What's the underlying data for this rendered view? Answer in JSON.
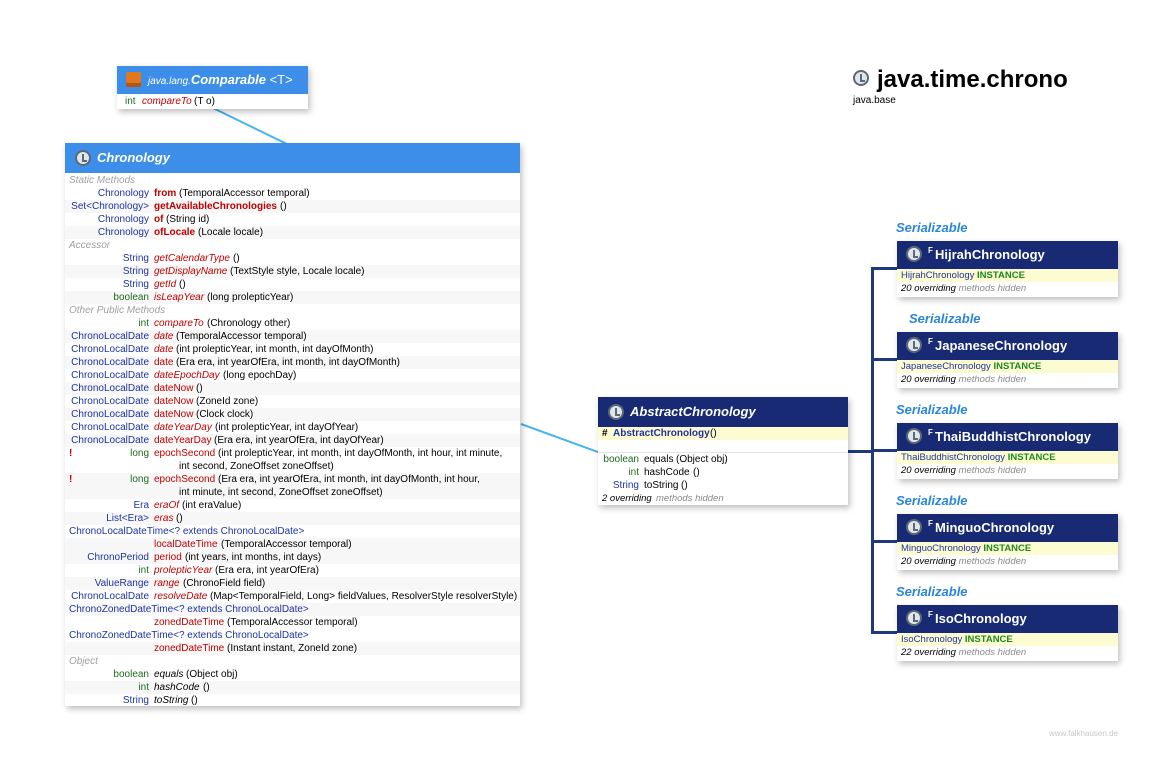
{
  "package": {
    "title": "java.time.chrono",
    "module": "java.base"
  },
  "comparable": {
    "prefix": "java.lang.",
    "name": "Comparable",
    "generic": "<T>",
    "method": {
      "ret": "int",
      "name": "compareTo",
      "params": "(T o)"
    }
  },
  "chronology": {
    "name": "Chronology",
    "sections": {
      "static": "Static Methods",
      "accessor": "Accessor",
      "other": "Other Public Methods",
      "object": "Object"
    },
    "static_rows": [
      {
        "ret": "Chronology",
        "name": "from",
        "params": "(TemporalAccessor temporal)"
      },
      {
        "ret": "Set<Chronology>",
        "name": "getAvailableChronologies",
        "params": "()"
      },
      {
        "ret": "Chronology",
        "name": "of",
        "params": "(String id)"
      },
      {
        "ret": "Chronology",
        "name": "ofLocale",
        "params": "(Locale locale)"
      }
    ],
    "accessor_rows": [
      {
        "ret": "String",
        "name": "getCalendarType",
        "params": "()"
      },
      {
        "ret": "String",
        "name": "getDisplayName",
        "params": "(TextStyle style, Locale locale)"
      },
      {
        "ret": "String",
        "name": "getId",
        "params": "()"
      },
      {
        "ret": "boolean",
        "name": "isLeapYear",
        "params": "(long prolepticYear)"
      }
    ],
    "other_rows": [
      {
        "ret": "int",
        "name": "compareTo",
        "params": "(Chronology other)",
        "style": "it"
      },
      {
        "ret": "ChronoLocalDate",
        "name": "date",
        "params": "(TemporalAccessor temporal)",
        "style": "it"
      },
      {
        "ret": "ChronoLocalDate",
        "name": "date",
        "params": "(int prolepticYear, int month, int dayOfMonth)",
        "style": "it"
      },
      {
        "ret": "ChronoLocalDate",
        "name": "date",
        "params": "(Era era, int yearOfEra, int month, int dayOfMonth)",
        "style": "pl"
      },
      {
        "ret": "ChronoLocalDate",
        "name": "dateEpochDay",
        "params": "(long epochDay)",
        "style": "it"
      },
      {
        "ret": "ChronoLocalDate",
        "name": "dateNow",
        "params": "()",
        "style": "pl"
      },
      {
        "ret": "ChronoLocalDate",
        "name": "dateNow",
        "params": "(ZoneId zone)",
        "style": "pl"
      },
      {
        "ret": "ChronoLocalDate",
        "name": "dateNow",
        "params": "(Clock clock)",
        "style": "pl"
      },
      {
        "ret": "ChronoLocalDate",
        "name": "dateYearDay",
        "params": "(int prolepticYear, int dayOfYear)",
        "style": "it"
      },
      {
        "ret": "ChronoLocalDate",
        "name": "dateYearDay",
        "params": "(Era era, int yearOfEra, int dayOfYear)",
        "style": "pl"
      },
      {
        "flag": "!",
        "ret": "long",
        "name": "epochSecond",
        "params": "(int prolepticYear, int month, int dayOfMonth, int hour, int minute,",
        "cont": "int second, ZoneOffset zoneOffset)",
        "style": "pl"
      },
      {
        "flag": "!",
        "ret": "long",
        "name": "epochSecond",
        "params": "(Era era, int yearOfEra, int month, int dayOfMonth, int hour,",
        "cont": "int minute, int second, ZoneOffset zoneOffset)",
        "style": "pl"
      },
      {
        "ret": "Era",
        "name": "eraOf",
        "params": "(int eraValue)",
        "style": "it"
      },
      {
        "ret": "List<Era>",
        "name": "eras",
        "params": "()",
        "style": "it"
      },
      {
        "ret": "ChronoLocalDateTime<? extends ChronoLocalDate>",
        "name": "localDateTime",
        "params": "(TemporalAccessor temporal)",
        "style": "pl",
        "wide": true
      },
      {
        "ret": "ChronoPeriod",
        "name": "period",
        "params": "(int years, int months, int days)",
        "style": "pl"
      },
      {
        "ret": "int",
        "name": "prolepticYear",
        "params": "(Era era, int yearOfEra)",
        "style": "it"
      },
      {
        "ret": "ValueRange",
        "name": "range",
        "params": "(ChronoField field)",
        "style": "it"
      },
      {
        "ret": "ChronoLocalDate",
        "name": "resolveDate",
        "params": "(Map<TemporalField, Long> fieldValues, ResolverStyle resolverStyle)",
        "style": "it"
      },
      {
        "ret": "ChronoZonedDateTime<? extends ChronoLocalDate>",
        "name": "zonedDateTime",
        "params": "(TemporalAccessor temporal)",
        "style": "pl",
        "wide": true
      },
      {
        "ret": "ChronoZonedDateTime<? extends ChronoLocalDate>",
        "name": "zonedDateTime",
        "params": "(Instant instant, ZoneId zone)",
        "style": "pl",
        "wide": true
      }
    ],
    "object_rows": [
      {
        "ret": "boolean",
        "name": "equals",
        "params": "(Object obj)"
      },
      {
        "ret": "int",
        "name": "hashCode",
        "params": "()"
      },
      {
        "ret": "String",
        "name": "toString",
        "params": "()"
      }
    ]
  },
  "abstract": {
    "name": "AbstractChronology",
    "ctor": {
      "flag": "#",
      "name": "AbstractChronology",
      "params": "()"
    },
    "rows": [
      {
        "ret": "boolean",
        "name": "equals",
        "params": "(Object obj)"
      },
      {
        "ret": "int",
        "name": "hashCode",
        "params": "()"
      },
      {
        "ret": "String",
        "name": "toString",
        "params": "()"
      }
    ],
    "hidden": {
      "count": "2 overriding",
      "rest": "methods hidden"
    }
  },
  "subclasses": [
    {
      "marker": "Serializable",
      "flag": "F",
      "name": "HijrahChronology",
      "inst_type": "HijrahChronology",
      "inst": "INSTANCE",
      "hidden_count": "20 overriding",
      "hidden_rest": "methods hidden"
    },
    {
      "marker": "Serializable",
      "flag": "F",
      "name": "JapaneseChronology",
      "inst_type": "JapaneseChronology",
      "inst": "INSTANCE",
      "hidden_count": "20 overriding",
      "hidden_rest": "methods hidden"
    },
    {
      "marker": "Serializable",
      "flag": "F",
      "name": "ThaiBuddhistChronology",
      "inst_type": "ThaiBuddhistChronology",
      "inst": "INSTANCE",
      "hidden_count": "20 overriding",
      "hidden_rest": "methods hidden"
    },
    {
      "marker": "Serializable",
      "flag": "F",
      "name": "MinguoChronology",
      "inst_type": "MinguoChronology",
      "inst": "INSTANCE",
      "hidden_count": "20 overriding",
      "hidden_rest": "methods hidden"
    },
    {
      "marker": "Serializable",
      "flag": "F",
      "name": "IsoChronology",
      "inst_type": "IsoChronology",
      "inst": "INSTANCE",
      "hidden_count": "22 overriding",
      "hidden_rest": "methods hidden"
    }
  ],
  "footer": "www.falkhausen.de"
}
